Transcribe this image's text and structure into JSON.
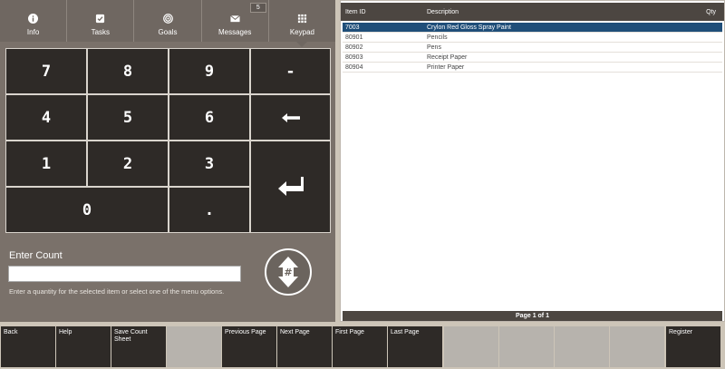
{
  "tabs": [
    {
      "label": "Info",
      "icon": "info-icon"
    },
    {
      "label": "Tasks",
      "icon": "checkbox-icon"
    },
    {
      "label": "Goals",
      "icon": "target-icon"
    },
    {
      "label": "Messages",
      "icon": "envelope-icon",
      "badge": "5"
    },
    {
      "label": "Keypad",
      "icon": "keypad-grid-icon",
      "active": true
    }
  ],
  "keypad": {
    "k7": "7",
    "k8": "8",
    "k9": "9",
    "minus": "-",
    "k4": "4",
    "k5": "5",
    "k6": "6",
    "k1": "1",
    "k2": "2",
    "k3": "3",
    "k0": "0",
    "dot": "."
  },
  "entry": {
    "label": "Enter Count",
    "value": "",
    "help": "Enter a quantity for the selected item or select one of the menu options."
  },
  "table": {
    "columns": {
      "item_id": "Item ID",
      "description": "Description",
      "qty": "Qty"
    },
    "rows": [
      {
        "id": "7003",
        "desc": "Crylon Red Gloss Spray Paint",
        "qty": "",
        "selected": true
      },
      {
        "id": "80901",
        "desc": "Pencils",
        "qty": ""
      },
      {
        "id": "80902",
        "desc": "Pens",
        "qty": ""
      },
      {
        "id": "80903",
        "desc": "Receipt Paper",
        "qty": ""
      },
      {
        "id": "80904",
        "desc": "Printer Paper",
        "qty": ""
      }
    ],
    "pager": "Page 1 of 1"
  },
  "toolbar": [
    {
      "label": "Back",
      "enabled": true
    },
    {
      "label": "Help",
      "enabled": true
    },
    {
      "label": "Save Count Sheet",
      "enabled": true
    },
    {
      "label": "",
      "enabled": false
    },
    {
      "label": "Previous Page",
      "enabled": true
    },
    {
      "label": "Next Page",
      "enabled": true
    },
    {
      "label": "First Page",
      "enabled": true
    },
    {
      "label": "Last Page",
      "enabled": true
    },
    {
      "label": "",
      "enabled": false
    },
    {
      "label": "",
      "enabled": false
    },
    {
      "label": "",
      "enabled": false
    },
    {
      "label": "",
      "enabled": false
    },
    {
      "label": "Register",
      "enabled": true
    }
  ],
  "colors": {
    "selected_row": "#1f4e79",
    "key": "#2e2a27",
    "panel": "#7a716a"
  }
}
